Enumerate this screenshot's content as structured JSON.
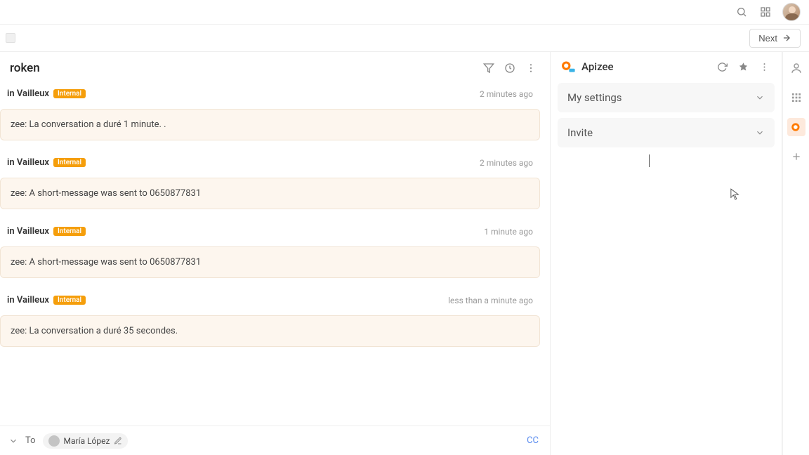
{
  "topbar": {
    "search_icon": "search",
    "apps_icon": "apps"
  },
  "actionrow": {
    "next_label": "Next"
  },
  "conversation": {
    "title": "roken",
    "filter_icon": "filter",
    "history_icon": "history",
    "more_icon": "more",
    "messages": [
      {
        "author": "in Vailleux",
        "badge": "Internal",
        "time": "2 minutes ago",
        "body": "zee: La conversation a duré 1 minute. ."
      },
      {
        "author": "in Vailleux",
        "badge": "Internal",
        "time": "2 minutes ago",
        "body": "zee: A short-message was sent to 0650877831"
      },
      {
        "author": "in Vailleux",
        "badge": "Internal",
        "time": "1 minute ago",
        "body": "zee: A short-message was sent to 0650877831"
      },
      {
        "author": "in Vailleux",
        "badge": "Internal",
        "time": "less than a minute ago",
        "body": "zee: La conversation a duré 35 secondes."
      }
    ]
  },
  "compose": {
    "to_label": "To",
    "recipient": "María López",
    "cc_label": "CC"
  },
  "sidepanel": {
    "app_name": "Apizee",
    "sections": [
      {
        "label": "My settings"
      },
      {
        "label": "Invite"
      }
    ]
  }
}
